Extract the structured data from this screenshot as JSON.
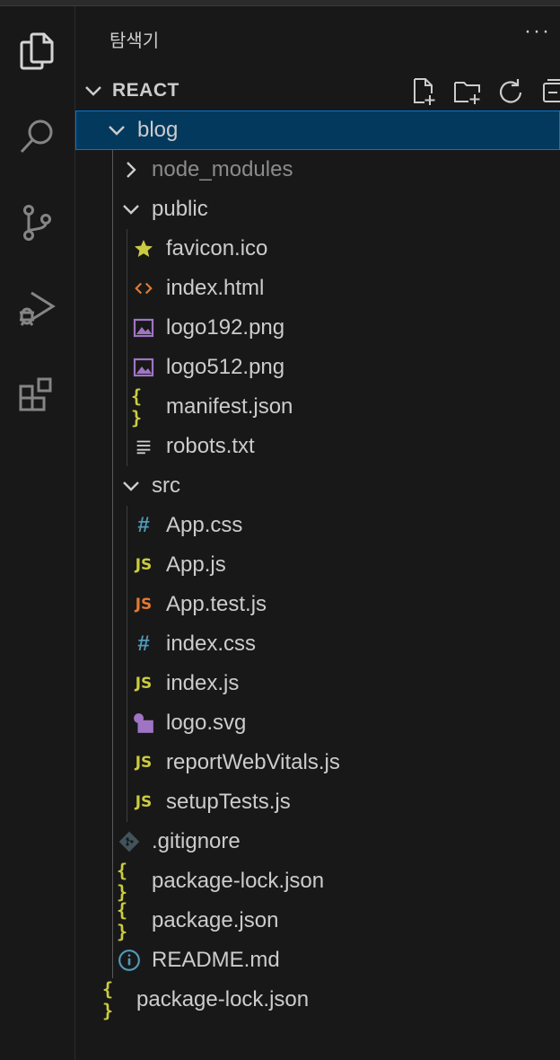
{
  "explorer": {
    "title": "탐색기",
    "more": "···",
    "section": "REACT"
  },
  "tree": [
    {
      "label": "blog",
      "kind": "folder-open",
      "depth": 0
    },
    {
      "label": "node_modules",
      "kind": "folder-closed",
      "depth": 1
    },
    {
      "label": "public",
      "kind": "folder-open",
      "depth": 1
    },
    {
      "label": "favicon.ico",
      "kind": "star-icon",
      "depth": 2
    },
    {
      "label": "index.html",
      "kind": "html-icon",
      "depth": 2
    },
    {
      "label": "logo192.png",
      "kind": "image-icon",
      "depth": 2
    },
    {
      "label": "logo512.png",
      "kind": "image-icon",
      "depth": 2
    },
    {
      "label": "manifest.json",
      "kind": "json-icon",
      "depth": 2
    },
    {
      "label": "robots.txt",
      "kind": "text-icon",
      "depth": 2
    },
    {
      "label": "src",
      "kind": "folder-open",
      "depth": 1
    },
    {
      "label": "App.css",
      "kind": "css-icon",
      "depth": 2
    },
    {
      "label": "App.js",
      "kind": "js-icon",
      "depth": 2
    },
    {
      "label": "App.test.js",
      "kind": "js-test-icon",
      "depth": 2
    },
    {
      "label": "index.css",
      "kind": "css-icon",
      "depth": 2
    },
    {
      "label": "index.js",
      "kind": "js-icon",
      "depth": 2
    },
    {
      "label": "logo.svg",
      "kind": "svg-icon",
      "depth": 2
    },
    {
      "label": "reportWebVitals.js",
      "kind": "js-icon",
      "depth": 2
    },
    {
      "label": "setupTests.js",
      "kind": "js-icon",
      "depth": 2
    },
    {
      "label": ".gitignore",
      "kind": "git-icon",
      "depth": 1
    },
    {
      "label": "package-lock.json",
      "kind": "json-icon",
      "depth": 1
    },
    {
      "label": "package.json",
      "kind": "json-icon",
      "depth": 1
    },
    {
      "label": "README.md",
      "kind": "info-icon",
      "depth": 1
    },
    {
      "label": "package-lock.json",
      "kind": "json-icon",
      "depth": 0
    }
  ],
  "colors": {
    "background": "#181818",
    "selected_row": "#04395e",
    "focus_border": "#0078d4",
    "js_yellow": "#cbcb41",
    "js_test_orange": "#e37933",
    "css_blue": "#519aba",
    "image_purple": "#a074c4",
    "html_orange": "#e37933"
  }
}
